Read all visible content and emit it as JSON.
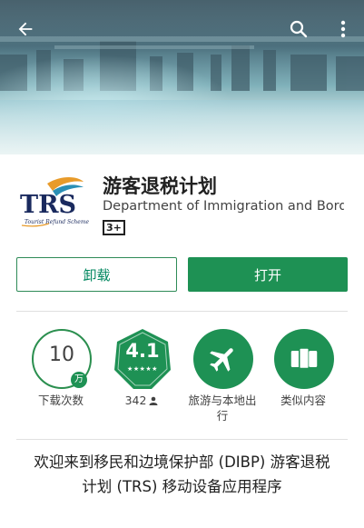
{
  "header": {
    "back_icon": "arrow-left-icon",
    "search_icon": "search-icon",
    "more_icon": "more-vertical-icon",
    "text_color": "#ffffff"
  },
  "app": {
    "title": "游客退税计划",
    "developer": "Department of Immigration and Bord..",
    "content_rating": "3+",
    "icon": {
      "logo_text": "TRS",
      "logo_subtext": "Tourist Refund Scheme",
      "colors": {
        "text": "#1a2a5e",
        "swoosh": "#e89b2a",
        "swoosh2": "#2a8fb5"
      }
    }
  },
  "actions": {
    "uninstall_label": "卸载",
    "open_label": "打开",
    "accent_color": "#1e9154"
  },
  "stats": {
    "downloads": {
      "value": "10",
      "unit": "万",
      "label": "下载次数"
    },
    "rating": {
      "value": "4.1",
      "stars": "★★★★★",
      "count": "342",
      "count_icon": "person-icon"
    },
    "category": {
      "label": "旅游与本地出行",
      "icon": "airplane-icon"
    },
    "similar": {
      "label": "类似内容",
      "icon": "cards-icon"
    }
  },
  "description": "欢迎来到移民和边境保护部 (DIBP) 游客退税计划 (TRS) 移动设备应用程序"
}
